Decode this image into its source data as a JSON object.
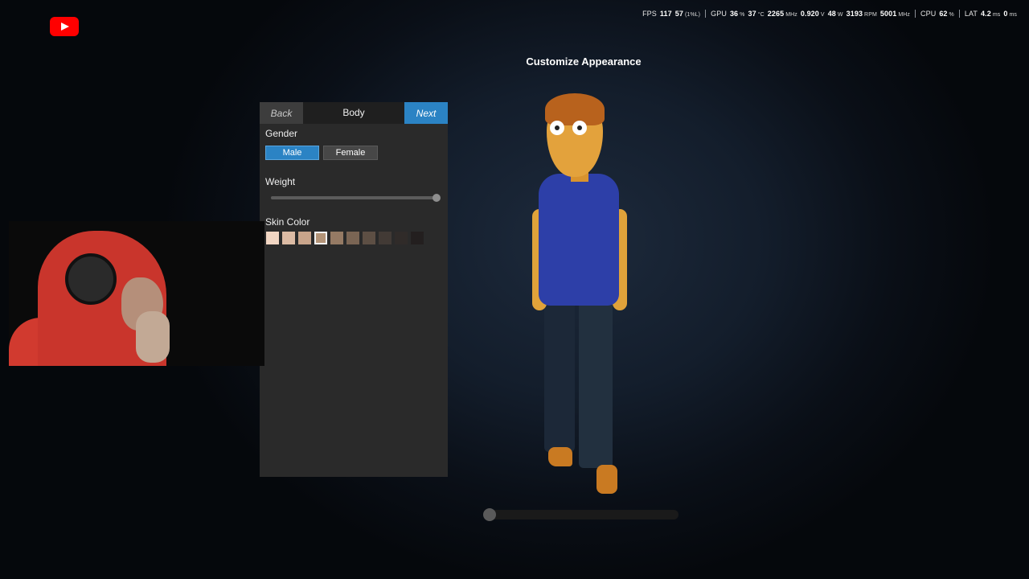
{
  "overlay": {
    "logo_icon": "youtube-logo"
  },
  "hud": {
    "fps": {
      "label": "FPS",
      "value": "117",
      "low": "57",
      "low_note": "(1%L)"
    },
    "gpu": {
      "label": "GPU",
      "usage": "36",
      "usage_unit": "%",
      "temp": "37",
      "temp_unit": "°C",
      "clock": "2265",
      "clock_unit": "MHz",
      "voltage": "0.920",
      "voltage_unit": "V",
      "power": "48",
      "power_unit": "W",
      "fan": "3193",
      "fan_unit": "RPM",
      "mem_clock": "5001",
      "mem_clock_unit": "MHz"
    },
    "cpu": {
      "label": "CPU",
      "usage": "62",
      "usage_unit": "%"
    },
    "lat": {
      "label": "LAT",
      "value": "4.2",
      "unit": "ms",
      "value2": "0",
      "unit2": "ms"
    }
  },
  "screen": {
    "title": "Customize Appearance"
  },
  "panel": {
    "back_label": "Back",
    "title": "Body",
    "next_label": "Next",
    "gender": {
      "label": "Gender",
      "options": [
        "Male",
        "Female"
      ],
      "selected": "Male"
    },
    "weight": {
      "label": "Weight",
      "value": 1.0
    },
    "skin_color": {
      "label": "Skin Color",
      "swatches": [
        "#f1d6c3",
        "#dcbba4",
        "#c9a58b",
        "#b39478",
        "#957a64",
        "#7a6554",
        "#5d4f44",
        "#423a35",
        "#302b29",
        "#231f1f"
      ],
      "selected_index": 3
    }
  },
  "preview_slider": {
    "value": 0.02
  },
  "colors": {
    "accent": "#2b83c4",
    "panel_bg": "#2a2a2a"
  }
}
